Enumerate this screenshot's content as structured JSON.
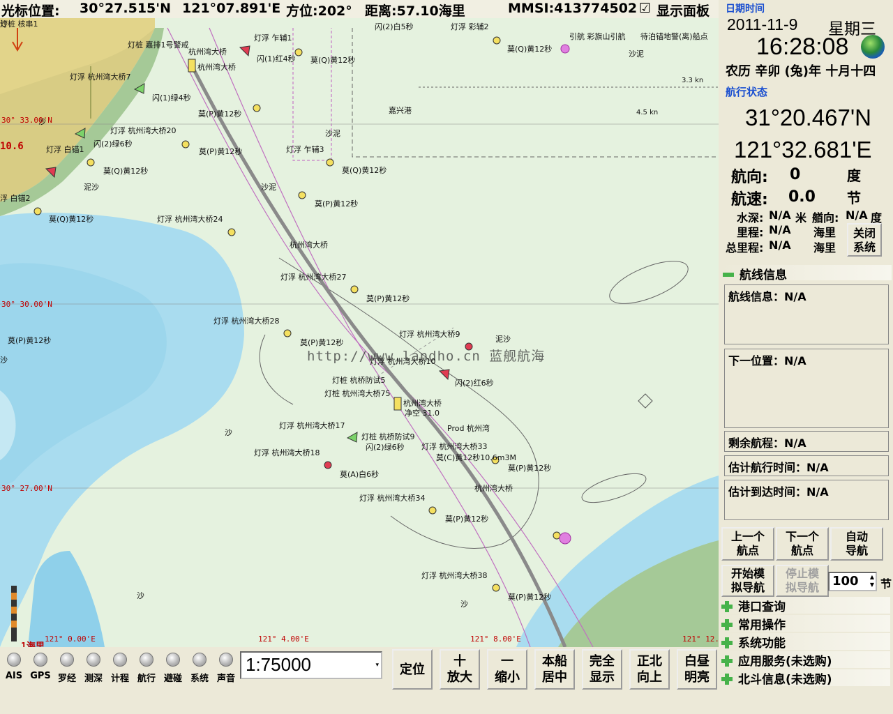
{
  "topbar": {
    "cursor_label": "光标位置:",
    "lat": "30°27.515'N",
    "lon": "121°07.891'E",
    "bearing": "方位:202°",
    "distance": "距离:57.10海里",
    "mmsi": "MMSI:413774502",
    "show_panel_check": "☑",
    "show_panel": "显示面板"
  },
  "datetime": {
    "title": "日期时间",
    "date": "2011-11-9",
    "weekday": "星期三",
    "time": "16:28:08",
    "lunar": "农历 辛卯 (兔)年 十月十四"
  },
  "nav": {
    "title": "航行状态",
    "lat": "31°20.467'N",
    "lon": "121°32.681'E",
    "heading_label": "航向:",
    "heading": "0",
    "heading_unit": "度",
    "speed_label": "航速:",
    "speed": "0.0",
    "speed_unit": "节",
    "depth_label": "水深:",
    "depth": "N/A",
    "depth_unit": "米",
    "bow_label": "艏向:",
    "bow": "N/A",
    "bow_unit": "度",
    "trip_label": "里程:",
    "trip": "N/A",
    "trip_unit": "海里",
    "total_label": "总里程:",
    "total": "N/A",
    "total_unit": "海里",
    "close_btn": "关闭\n系统"
  },
  "route": {
    "title": "航线信息",
    "route_info": "航线信息：N/A",
    "next_pos": "下一位置：N/A",
    "remain": "剩余航程：N/A",
    "eta_dur": "估计航行时间：N/A",
    "eta": "估计到达时间：N/A",
    "btn_prev": "上一个\n航点",
    "btn_next": "下一个\n航点",
    "btn_auto": "自动\n导航",
    "btn_sim_start": "开始模\n拟导航",
    "btn_sim_stop": "停止模\n拟导航",
    "sim_speed": "100",
    "sim_speed_unit": "节"
  },
  "menu": [
    "港口查询",
    "常用操作",
    "系统功能",
    "应用服务(未选购)",
    "北斗信息(未选购)"
  ],
  "indicators": [
    "AIS",
    "GPS",
    "罗经",
    "测深",
    "计程",
    "航行",
    "避碰",
    "系统",
    "声音"
  ],
  "scale": "1:75000",
  "buttons": [
    "定位",
    "十\n放大",
    "一\n缩小",
    "本船\n居中",
    "完全\n显示",
    "正北\n向上",
    "白昼\n明亮"
  ],
  "map": {
    "watermark": "http://www.landho.cn 蓝舰航海",
    "lat_labels": [
      "30° 33.00'N",
      "30° 30.00'N",
      "30° 27.00'N"
    ],
    "lon_labels": [
      "121° 0.00'E",
      "121° 4.00'E",
      "121° 8.00'E",
      "121° 12."
    ],
    "side_value": "10.6",
    "scale_label": "1海里",
    "currents": [
      "3.3 kn",
      "4.5 kn"
    ],
    "labels": [
      "灯桩 嘉排1号警戒",
      "杭州湾大桥",
      "杭州湾大桥",
      "灯浮 杭州湾大桥7",
      "闪(1)红4秒",
      "莫(Q)黄12秒",
      "灯浮 乍辅1",
      "灯浮 彩辅2",
      "闪(2)白5秒",
      "闪(1)绿4秒",
      "灯浮 杭州湾大桥20",
      "闪(2)绿6秒",
      "灯浮 白锚1",
      "莫(P)黄12秒",
      "莫(Q)黄12秒",
      "泥沙",
      "浮 白锚2",
      "莫(Q)黄12秒",
      "灯浮 杭州湾大桥24",
      "莫(P)黄12秒",
      "灯浮 乍辅3",
      "莫(Q)黄12秒",
      "莫(P)黄12秒",
      "嘉兴港",
      "沙泥",
      "引航 彩旗山引航",
      "待泊锚地警(离)船点",
      "莫(Q)黄12秒",
      "沙泥",
      "杭州湾大桥",
      "灯浮 杭州湾大桥27",
      "莫(P)黄12秒",
      "灯浮 杭州湾大桥28",
      "莫(P)黄12秒",
      "灯浮 杭州湾大桥9",
      "泥沙",
      "灯浮 杭州湾大桥10",
      "闪(2)红6秒",
      "灯桩 杭桥防试5",
      "灯桩 杭州湾大桥75",
      "杭州湾大桥",
      "净空 31.0",
      "灯浮 杭州湾大桥17",
      "灯桩 杭桥防试9",
      "Prod 杭州湾",
      "闪(2)绿6秒",
      "灯浮 杭州湾大桥33",
      "灯浮 杭州湾大桥18",
      "莫(C)黄12秒10.6m3M",
      "莫(P)黄12秒",
      "莫(A)白6秒",
      "杭州湾大桥",
      "灯浮 杭州湾大桥34",
      "莫(P)黄12秒",
      "莫(P)黄12秒",
      "灯浮 杭州湾大桥38",
      "莫(P)黄12秒",
      "沙泥",
      "沙",
      "沙",
      "沙",
      "沙",
      "沙",
      "沙",
      "灯桩 核串1"
    ]
  }
}
